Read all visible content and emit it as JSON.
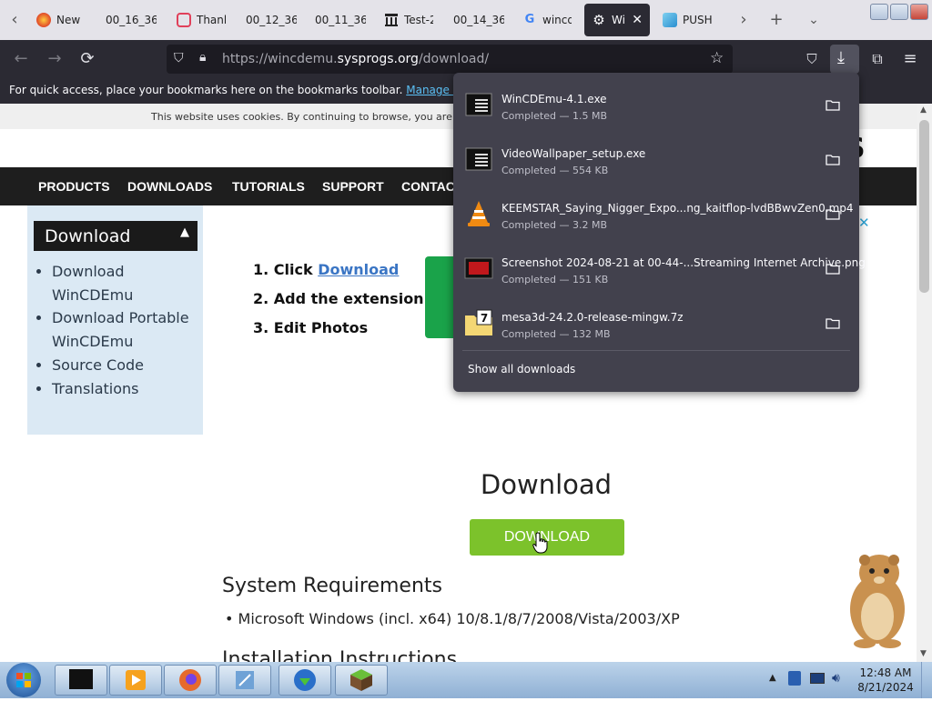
{
  "browser": {
    "tabs": [
      {
        "title": "New",
        "icon": "firefox-icon",
        "active": false
      },
      {
        "title": "00_16_36",
        "icon": "blank-icon",
        "active": false
      },
      {
        "title": "Thank",
        "icon": "asana-icon",
        "active": false
      },
      {
        "title": "00_12_36",
        "icon": "blank-icon",
        "active": false
      },
      {
        "title": "00_11_36",
        "icon": "blank-icon",
        "active": false
      },
      {
        "title": "Test-2",
        "icon": "building-icon",
        "active": false
      },
      {
        "title": "00_14_36",
        "icon": "blank-icon",
        "active": false
      },
      {
        "title": "wincd",
        "icon": "google-icon",
        "active": false
      },
      {
        "title": "Wi",
        "icon": "gear-icon",
        "active": true
      },
      {
        "title": "PUSH",
        "icon": "push-icon",
        "active": false
      }
    ],
    "url_prefix": "https://wincdemu.",
    "url_domain": "sysprogs.org",
    "url_path": "/download/",
    "bookmarks_text": "For quick access, place your bookmarks here on the bookmarks toolbar.",
    "bookmarks_link": "Manage bookmarks..."
  },
  "page": {
    "cookie_text": "This website uses cookies. By continuing to browse, you are agree",
    "logo_fragment": "S",
    "nav": [
      "PRODUCTS",
      "DOWNLOADS",
      "TUTORIALS",
      "SUPPORT",
      "CONTAC"
    ],
    "sidebar": {
      "title": "Download",
      "items": [
        "Download WinCDEmu",
        "Download Portable WinCDEmu",
        "Source Code",
        "Translations"
      ]
    },
    "steps": [
      {
        "num": "1.",
        "text": "Click ",
        "link": "Download"
      },
      {
        "num": "2.",
        "text": "Add the extension"
      },
      {
        "num": "3.",
        "text": "Edit Photos"
      }
    ],
    "download_heading": "Download",
    "download_button": "DOWNLOAD",
    "sysreq_heading": "System Requirements",
    "sysreq_item": "Microsoft Windows (incl. x64) 10/8.1/8/7/2008/Vista/2003/XP",
    "install_heading": "Installation Instructions"
  },
  "downloads_panel": {
    "items": [
      {
        "name": "WinCDEmu-4.1.exe",
        "status": "Completed — 1.5 MB",
        "icon": "exe-icon"
      },
      {
        "name": "VideoWallpaper_setup.exe",
        "status": "Completed — 554 KB",
        "icon": "exe-icon"
      },
      {
        "name": "KEEMSTAR_Saying_Nigger_Expo...ng_kaitflop-lvdBBwvZen0.mp4",
        "status": "Completed — 3.2 MB",
        "icon": "vlc-cone-icon"
      },
      {
        "name": "Screenshot 2024-08-21 at 00-44-...Streaming Internet Archive.png",
        "status": "Completed — 151 KB",
        "icon": "image-file-icon"
      },
      {
        "name": "mesa3d-24.2.0-release-mingw.7z",
        "status": "Completed — 132 MB",
        "icon": "7z-archive-icon"
      }
    ],
    "show_all": "Show all downloads"
  },
  "taskbar": {
    "time": "12:48 AM",
    "date": "8/21/2024"
  },
  "colors": {
    "browser_dark": "#2b2a33",
    "panel": "#42414d",
    "download_green": "#7cc22b",
    "site_nav": "#1e1e1e"
  }
}
